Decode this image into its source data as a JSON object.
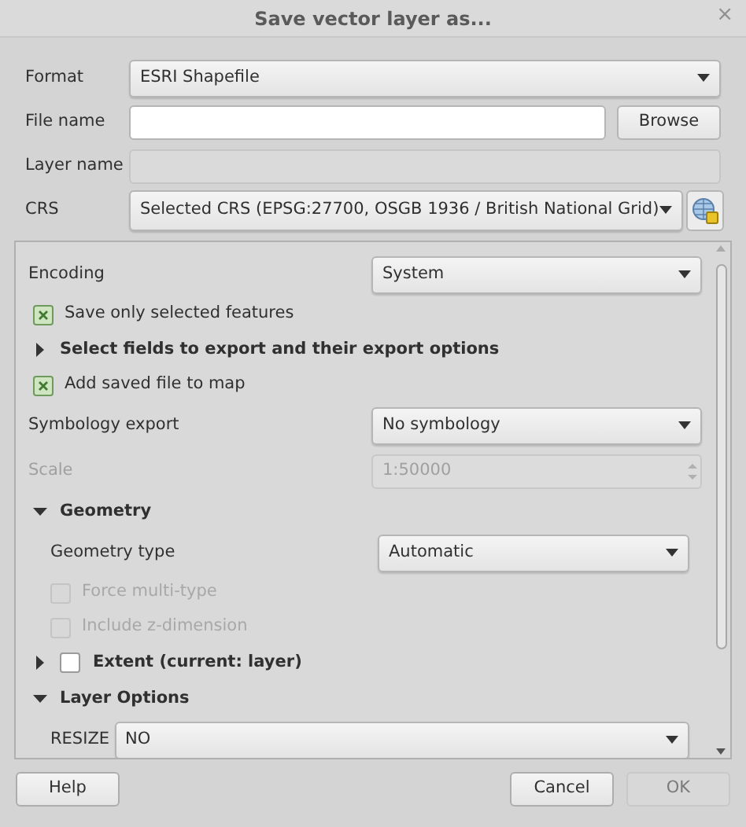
{
  "window": {
    "title": "Save vector layer as...",
    "close": "×"
  },
  "form": [
    {
      "kind": "select",
      "label": "Format",
      "value": "ESRI Shapefile"
    },
    {
      "kind": "browse",
      "label": "File name",
      "button": "Browse"
    },
    {
      "kind": "disabled_input",
      "label": "Layer name"
    },
    {
      "kind": "crs",
      "label": "CRS",
      "value": "Selected CRS (EPSG:27700, OSGB 1936 / British National Grid)"
    }
  ],
  "panel": [
    {
      "kind": "select",
      "label": "Encoding",
      "value": "System"
    },
    {
      "kind": "checkbox",
      "label": "Save only selected features",
      "checked": true,
      "disabled": false
    },
    {
      "kind": "section",
      "label": "Select fields to export and their export options",
      "expanded": false
    },
    {
      "kind": "checkbox",
      "label": "Add saved file to map",
      "checked": true,
      "disabled": false
    },
    {
      "kind": "select",
      "label": "Symbology export",
      "value": "No symbology"
    },
    {
      "kind": "spin",
      "label": "Scale",
      "value": "1:50000",
      "disabled": true
    },
    {
      "kind": "section",
      "label": "Geometry",
      "expanded": true,
      "children": [
        {
          "kind": "select",
          "label": "Geometry type",
          "value": "Automatic"
        },
        {
          "kind": "checkbox",
          "label": "Force multi-type",
          "checked": false,
          "disabled": true
        },
        {
          "kind": "checkbox",
          "label": "Include z-dimension",
          "checked": false,
          "disabled": true
        }
      ]
    },
    {
      "kind": "checksection",
      "label": "Extent (current: layer)",
      "expanded": false,
      "checked": false
    },
    {
      "kind": "section",
      "label": "Layer Options",
      "expanded": true,
      "children": [
        {
          "kind": "inline_select",
          "label": "RESIZE",
          "value": "NO"
        }
      ]
    }
  ],
  "buttons": [
    {
      "label": "Help",
      "disabled": false
    },
    {
      "label": "Cancel",
      "disabled": false
    },
    {
      "label": "OK",
      "disabled": true
    }
  ]
}
